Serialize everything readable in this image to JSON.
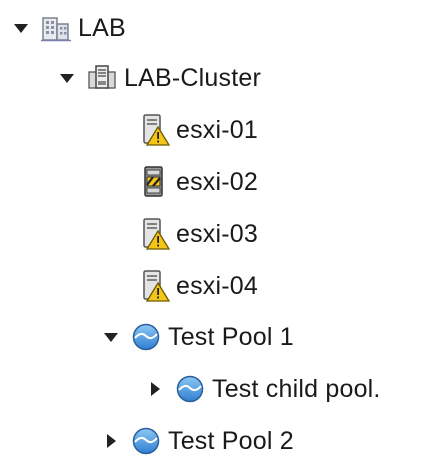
{
  "tree": {
    "datacenter": {
      "label": "LAB",
      "icon": "datacenter-icon",
      "expanded": true
    },
    "cluster": {
      "label": "LAB-Cluster",
      "icon": "cluster-icon",
      "expanded": true
    },
    "hosts": [
      {
        "label": "esxi-01",
        "icon": "host-warning-icon",
        "status": "warning"
      },
      {
        "label": "esxi-02",
        "icon": "host-maintenance-icon",
        "status": "maintenance"
      },
      {
        "label": "esxi-03",
        "icon": "host-warning-icon",
        "status": "warning"
      },
      {
        "label": "esxi-04",
        "icon": "host-warning-icon",
        "status": "warning"
      }
    ],
    "pools": [
      {
        "label": "Test Pool 1",
        "icon": "resource-pool-icon",
        "expanded": true,
        "children": [
          {
            "label": "Test child pool.",
            "icon": "resource-pool-icon",
            "expanded": false
          }
        ]
      },
      {
        "label": "Test Pool 2",
        "icon": "resource-pool-icon",
        "expanded": false
      }
    ]
  },
  "colors": {
    "warning": "#f5c518",
    "pool_blue": "#4a9be0",
    "host_gray": "#d0d0d0",
    "twisty": "#222222"
  }
}
